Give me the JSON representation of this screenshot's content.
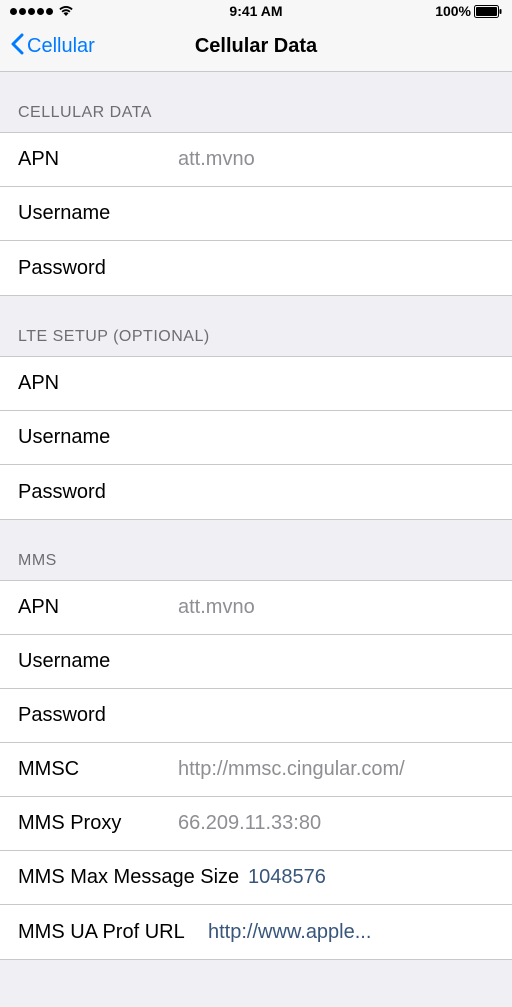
{
  "status": {
    "time": "9:41 AM",
    "battery": "100%"
  },
  "nav": {
    "back_label": "Cellular",
    "title": "Cellular Data"
  },
  "sections": {
    "cellular_data": {
      "header": "CELLULAR DATA",
      "apn_label": "APN",
      "apn_value": "att.mvno",
      "username_label": "Username",
      "username_value": "",
      "password_label": "Password",
      "password_value": ""
    },
    "lte": {
      "header": "LTE SETUP (OPTIONAL)",
      "apn_label": "APN",
      "apn_value": "",
      "username_label": "Username",
      "username_value": "",
      "password_label": "Password",
      "password_value": ""
    },
    "mms": {
      "header": "MMS",
      "apn_label": "APN",
      "apn_value": "att.mvno",
      "username_label": "Username",
      "username_value": "",
      "password_label": "Password",
      "password_value": "",
      "mmsc_label": "MMSC",
      "mmsc_value": "http://mmsc.cingular.com/",
      "proxy_label": "MMS Proxy",
      "proxy_value": "66.209.11.33:80",
      "maxsize_label": "MMS Max Message Size",
      "maxsize_value": "1048576",
      "uaprof_label": "MMS UA Prof URL",
      "uaprof_value": "http://www.apple..."
    }
  }
}
